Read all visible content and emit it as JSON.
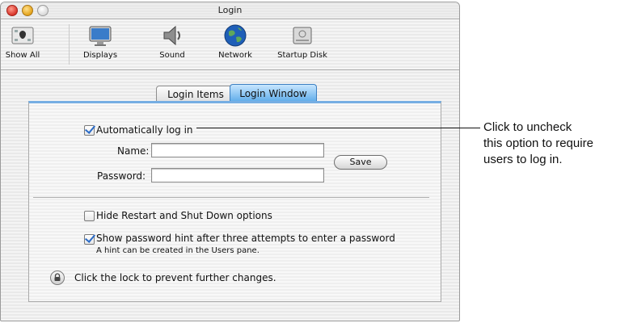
{
  "window": {
    "title": "Login"
  },
  "toolbar": {
    "items": [
      {
        "label": "Show All",
        "icon": "show-all-icon"
      },
      {
        "label": "Displays",
        "icon": "display-icon"
      },
      {
        "label": "Sound",
        "icon": "speaker-icon"
      },
      {
        "label": "Network",
        "icon": "globe-icon"
      },
      {
        "label": "Startup Disk",
        "icon": "disk-icon"
      }
    ]
  },
  "tabs": [
    {
      "label": "Login Items",
      "selected": false
    },
    {
      "label": "Login Window",
      "selected": true
    }
  ],
  "login_window": {
    "auto_login": {
      "label": "Automatically log in",
      "checked": true
    },
    "name_label": "Name:",
    "name_value": "",
    "password_label": "Password:",
    "password_value": "",
    "save_label": "Save",
    "hide_restart": {
      "label": "Hide Restart and Shut Down options",
      "checked": false
    },
    "password_hint": {
      "label": "Show password hint after three attempts to enter a password",
      "checked": true
    },
    "hint_note": "A hint can be created in the Users pane.",
    "lock_text": "Click the lock to prevent further changes."
  },
  "callout": {
    "lines": [
      "Click to uncheck",
      "this option to require",
      "users to log in."
    ]
  },
  "colors": {
    "accent": "#5aa9e8",
    "checkmark": "#2a6bc8"
  }
}
